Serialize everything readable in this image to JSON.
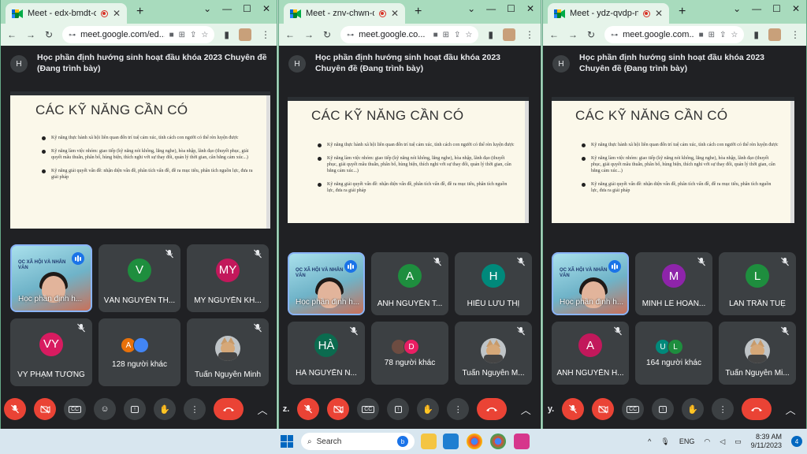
{
  "windows": [
    {
      "tab_title": "Meet - edx-bmdt-ccg",
      "url": "meet.google.com/ed...",
      "meeting_title": "Học phần định hướng sinh hoạt đầu khóa 2023 Chuyên đề (Đang trình bày)",
      "meeting_avatar": "H",
      "slide": {
        "title": "CÁC KỸ NĂNG CẦN CÓ",
        "bullets": [
          "Kỹ năng thực hành xã hội liên quan đến trí tuệ cảm xúc, tính cách con người có thể rèn luyện được",
          "Kỹ năng làm việc nhóm: giao tiếp (kỹ năng nói không, lắng nghe), hòa nhập, lãnh đạo (thuyết phục, giải quyết mâu thuẫn, phân bổ, hùng biện, thích nghi với sự thay đổi, quản lý thời gian, cân bằng cảm xúc...)",
          "Kỹ năng giải quyết vấn đề: nhận diện vấn đề, phân tích vấn đề, đề ra mục tiêu, phân tích nguồn lực, đưa ra giải pháp"
        ]
      },
      "presenter": {
        "name": "Học phần định h...",
        "banner": "ỌC XÃ HỘI VÀ NHÂN VĂN"
      },
      "participants": [
        {
          "initials": "V",
          "name": "VÂN NGUYỄN TH...",
          "color": "#1e8e3e"
        },
        {
          "initials": "MY",
          "name": "MY NGUYỄN KH...",
          "color": "#c2185b"
        },
        {
          "initials": "VY",
          "name": "VY PHẠM TƯỜNG",
          "color": "#d81b60"
        }
      ],
      "others": {
        "label": "128 người khác",
        "minis": [
          {
            "initials": "A",
            "color": "#e8710a"
          },
          {
            "initials": "",
            "color": "#4285f4"
          }
        ]
      },
      "self_name": "Tuấn Nguyễn Minh",
      "controls_prefix": ""
    },
    {
      "tab_title": "Meet - znv-chwn-dde",
      "url": "meet.google.co...",
      "meeting_title": "Học phần định hướng sinh hoạt đầu khóa 2023 Chuyên đề (Đang trình bày)",
      "meeting_avatar": "H",
      "slide": {
        "title": "CÁC KỸ NĂNG CẦN CÓ",
        "bullets": [
          "Kỹ năng thực hành xã hội liên quan đến trí tuệ cảm xúc, tính cách con người có thể rèn luyện được",
          "Kỹ năng làm việc nhóm: giao tiếp (kỹ năng nói không, lắng nghe), hòa nhập, lãnh đạo (thuyết phục, giải quyết mâu thuẫn, phân bổ, hùng biện, thích nghi với sự thay đổi, quản lý thời gian, cân bằng cảm xúc...)",
          "Kỹ năng giải quyết vấn đề: nhận diện vấn đề, phân tích vấn đề, đề ra mục tiêu, phân tích nguồn lực, đưa ra giải pháp"
        ]
      },
      "presenter": {
        "name": "Học phần định h...",
        "banner": "ỌC XÃ HỘI VÀ NHÂN VĂN"
      },
      "participants": [
        {
          "initials": "A",
          "name": "ANH NGUYỄN T...",
          "color": "#1e8e3e"
        },
        {
          "initials": "H",
          "name": "HIẾU LƯU THỊ",
          "color": "#00897b"
        },
        {
          "initials": "HÀ",
          "name": "HÀ NGUYỄN N...",
          "color": "#0b6b4f"
        }
      ],
      "others": {
        "label": "78 người khác",
        "minis": [
          {
            "initials": "",
            "color": "#6d4c41"
          },
          {
            "initials": "D",
            "color": "#e91e63"
          }
        ]
      },
      "self_name": "Tuấn Nguyễn M...",
      "controls_prefix": "z."
    },
    {
      "tab_title": "Meet - ydz-qvdp-nqi",
      "url": "meet.google.com...",
      "meeting_title": "Học phần định hướng sinh hoạt đầu khóa 2023 Chuyên đề (Đang trình bày)",
      "meeting_avatar": "H",
      "slide": {
        "title": "CÁC KỸ NĂNG CẦN CÓ",
        "bullets": [
          "Kỹ năng thực hành xã hội liên quan đến trí tuệ cảm xúc, tính cách con người có thể rèn luyện được",
          "Kỹ năng làm việc nhóm: giao tiếp (kỹ năng nói không, lắng nghe), hòa nhập, lãnh đạo (thuyết phục, giải quyết mâu thuẫn, phân bổ, hùng biện, thích nghi với sự thay đổi, quản lý thời gian, cân bằng cảm xúc...)",
          "Kỹ năng giải quyết vấn đề: nhận diện vấn đề, phân tích vấn đề, đề ra mục tiêu, phân tích nguồn lực, đưa ra giải pháp"
        ]
      },
      "presenter": {
        "name": "Học phần định h...",
        "banner": "ỌC XÃ HỘI VÀ NHÂN VĂN"
      },
      "participants": [
        {
          "initials": "M",
          "name": "MINH LÊ HOÀN...",
          "color": "#8e24aa"
        },
        {
          "initials": "L",
          "name": "LAN TRẦN TUỆ",
          "color": "#1e8e3e"
        },
        {
          "initials": "A",
          "name": "ANH NGUYỄN H...",
          "color": "#c2185b"
        }
      ],
      "others": {
        "label": "164 người khác",
        "minis": [
          {
            "initials": "U",
            "color": "#00897b"
          },
          {
            "initials": "L",
            "color": "#1e8e3e"
          }
        ]
      },
      "self_name": "Tuấn Nguyễn Mi...",
      "controls_prefix": "y."
    }
  ],
  "taskbar": {
    "search_placeholder": "Search",
    "language": "ENG",
    "time": "8:39 AM",
    "date": "9/11/2023",
    "notifications": "4"
  }
}
